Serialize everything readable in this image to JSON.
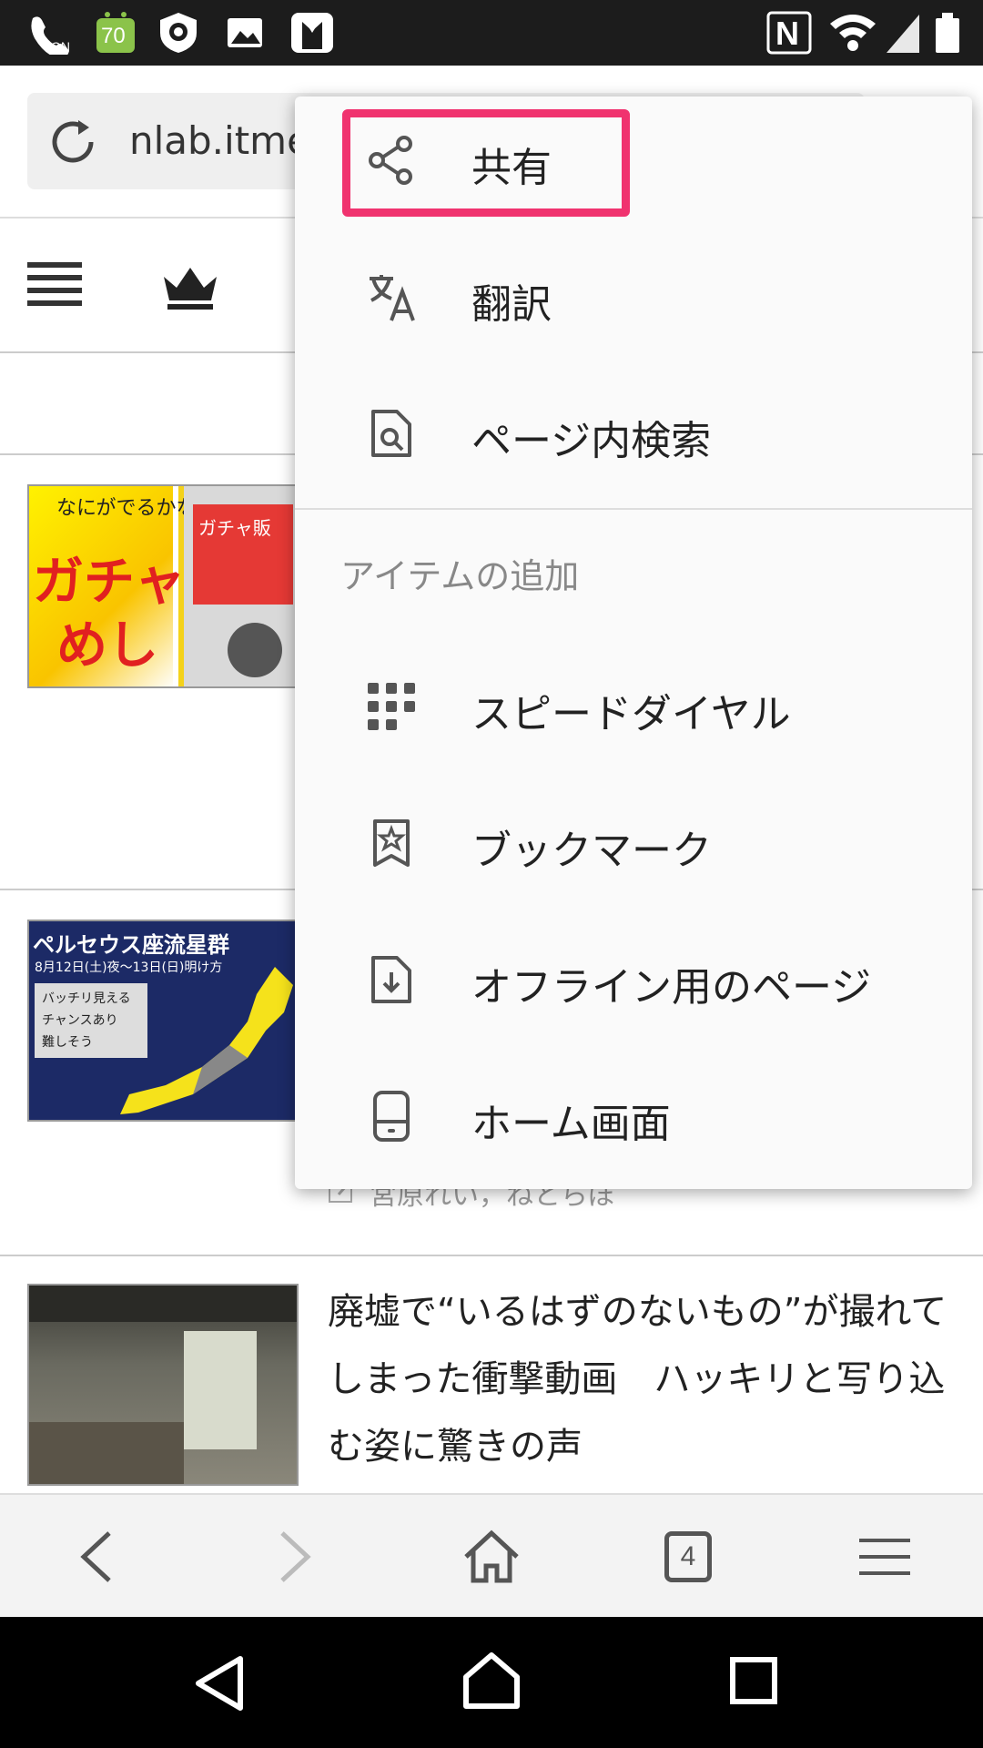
{
  "status_bar": {
    "battery_badge": "70",
    "nfc_letter": "N",
    "on_label": "ON",
    "icons": [
      "call-on-icon",
      "android-battery-icon",
      "shield-icon",
      "gallery-icon",
      "tuxedo-icon",
      "nfc-icon",
      "wifi-icon",
      "signal-icon",
      "battery-icon"
    ]
  },
  "browser": {
    "url": "nlab.itmedia.co.jp",
    "tab_count": "4"
  },
  "menu": {
    "items": [
      {
        "label": "共有",
        "icon": "share-icon"
      },
      {
        "label": "翻訳",
        "icon": "translate-icon"
      },
      {
        "label": "ページ内検索",
        "icon": "find-in-page-icon"
      }
    ],
    "section_title": "アイテムの追加",
    "add_items": [
      {
        "label": "スピードダイヤル",
        "icon": "speed-dial-icon"
      },
      {
        "label": "ブックマーク",
        "icon": "bookmark-icon"
      },
      {
        "label": "オフライン用のページ",
        "icon": "offline-page-icon"
      },
      {
        "label": "ホーム画面",
        "icon": "home-screen-icon"
      }
    ]
  },
  "articles": [
    {
      "thumb_texts": [
        "なにがでるかな?",
        "ガチャ",
        "めし",
        "ガチャ販"
      ]
    },
    {
      "thumb_texts": [
        "ペルセウス座流星群",
        "8月12日(土)夜〜13日(日)明け方",
        "バッチリ見える",
        "チャンスあり",
        "難しそう"
      ],
      "byline": "宮原れい，ねとらぼ"
    },
    {
      "title": "廃墟で“いるはずのないもの”が撮れてしまった衝撃動画　ハッキリと写り込む姿に驚きの声"
    }
  ],
  "colors": {
    "highlight": "#f0336f",
    "status_bar": "#1c1c1c",
    "nav_bar": "#000000",
    "menu_bg": "#fafafa"
  }
}
